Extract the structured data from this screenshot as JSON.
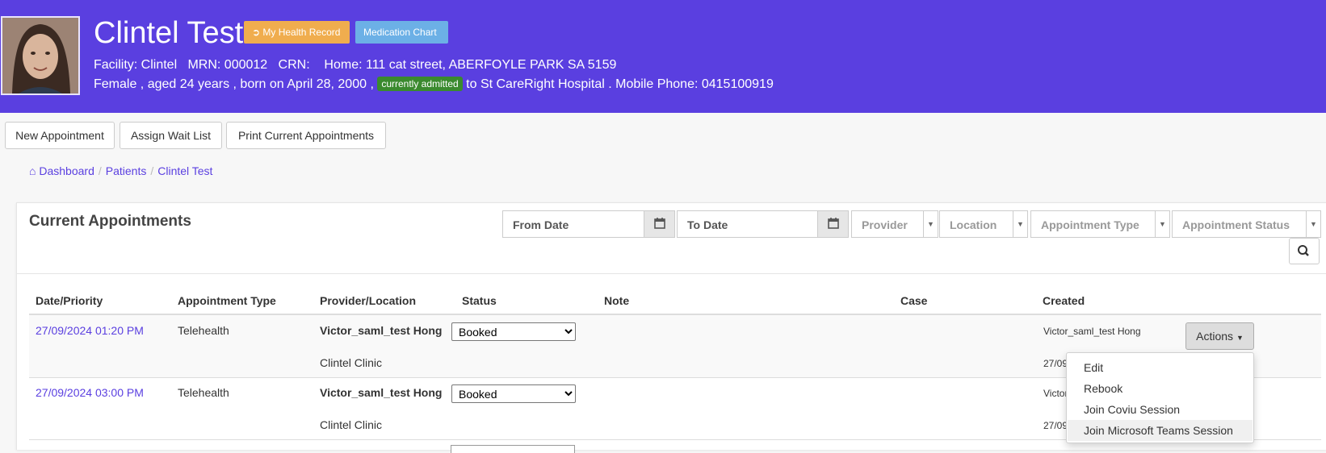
{
  "colors": {
    "header_bg": "#5a3fe0",
    "link": "#5a3fe0",
    "health_btn": "#f0ad4e",
    "med_btn": "#6cb0e6",
    "admitted_badge": "#3a8a2e"
  },
  "patient": {
    "name": "Clintel Test",
    "health_record_label": "My Health Record",
    "medication_chart_label": "Medication Chart",
    "line1": "Facility: Clintel   MRN: 000012   CRN:    Home: 111 cat street, ABERFOYLE PARK SA 5159",
    "line2_before": "Female , aged 24 years , born on April 28, 2000 , ",
    "admitted_badge": "currently admitted",
    "line2_after": " to St CareRight Hospital . Mobile Phone: 0415100919"
  },
  "toolbar": {
    "new_appointment": "New Appointment",
    "assign_wait_list": "Assign Wait List",
    "print_current": "Print Current Appointments"
  },
  "breadcrumb": {
    "dashboard": "Dashboard",
    "patients": "Patients",
    "patient": "Clintel Test"
  },
  "panel": {
    "title": "Current Appointments"
  },
  "filters": {
    "from_date": "From Date",
    "to_date": "To Date",
    "provider": "Provider",
    "location": "Location",
    "appointment_type": "Appointment Type",
    "appointment_status": "Appointment Status"
  },
  "table": {
    "headers": {
      "date": "Date/Priority",
      "type": "Appointment Type",
      "provider": "Provider/Location",
      "status": "Status",
      "note": "Note",
      "case": "Case",
      "created": "Created"
    },
    "rows": [
      {
        "date": "27/09/2024 01:20 PM",
        "type": "Telehealth",
        "provider": "Victor_saml_test Hong",
        "location": "Clintel Clinic",
        "status": "Booked",
        "created_by": "Victor_saml_test Hong",
        "created_date": "27/09"
      },
      {
        "date": "27/09/2024 03:00 PM",
        "type": "Telehealth",
        "provider": "Victor_saml_test Hong",
        "location": "Clintel Clinic",
        "status": "Booked",
        "created_by": "Victor",
        "created_date": "27/09"
      }
    ]
  },
  "actions": {
    "label": "Actions",
    "menu": [
      "Edit",
      "Rebook",
      "Join Coviu Session",
      "Join Microsoft Teams Session"
    ]
  }
}
